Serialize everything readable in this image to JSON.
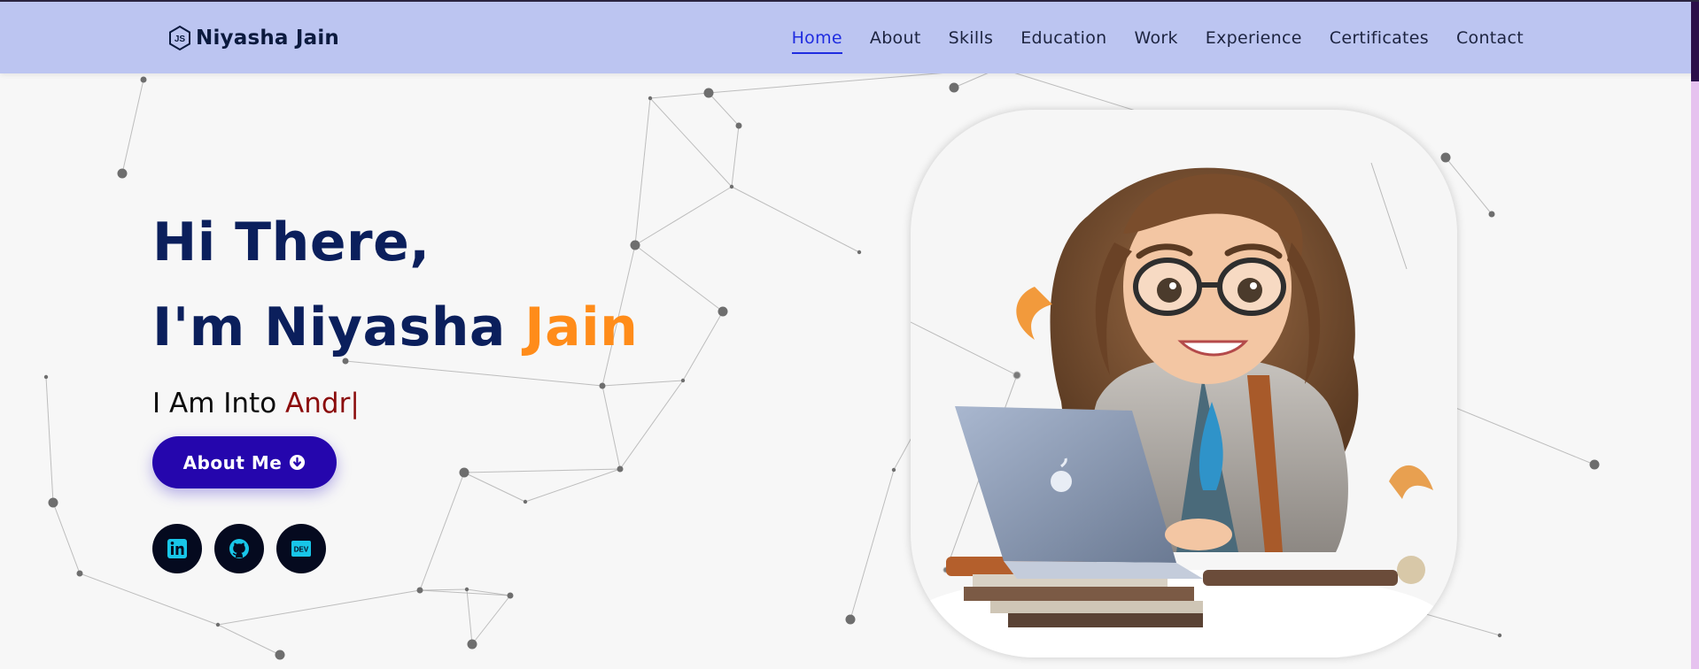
{
  "brand": {
    "name": "Niyasha Jain",
    "icon": "nodejs-hexagon-icon"
  },
  "nav": {
    "items": [
      {
        "label": "Home",
        "active": true
      },
      {
        "label": "About",
        "active": false
      },
      {
        "label": "Skills",
        "active": false
      },
      {
        "label": "Education",
        "active": false
      },
      {
        "label": "Work",
        "active": false
      },
      {
        "label": "Experience",
        "active": false
      },
      {
        "label": "Certificates",
        "active": false
      },
      {
        "label": "Contact",
        "active": false
      }
    ]
  },
  "hero": {
    "greeting": "Hi There,",
    "intro_prefix": "I'm Niyasha ",
    "intro_highlight": "Jain",
    "typed_prefix": "I Am Into ",
    "typed_text": "Andr",
    "cursor": "|",
    "about_button": "About Me",
    "about_button_icon": "arrow-down-circle-icon"
  },
  "socials": [
    {
      "name": "linkedin",
      "icon": "linkedin-icon"
    },
    {
      "name": "github",
      "icon": "github-icon"
    },
    {
      "name": "dev",
      "icon": "dev-icon",
      "label": "DEV"
    }
  ],
  "colors": {
    "navbar": "#bcc5f1",
    "heading": "#0b1f5c",
    "highlight": "#ff8c1a",
    "typed": "#8b0c0c",
    "button": "#2506ad",
    "nav_active": "#1f2ce0",
    "social_bg": "#050a1f",
    "social_icon": "#18c6e8"
  }
}
